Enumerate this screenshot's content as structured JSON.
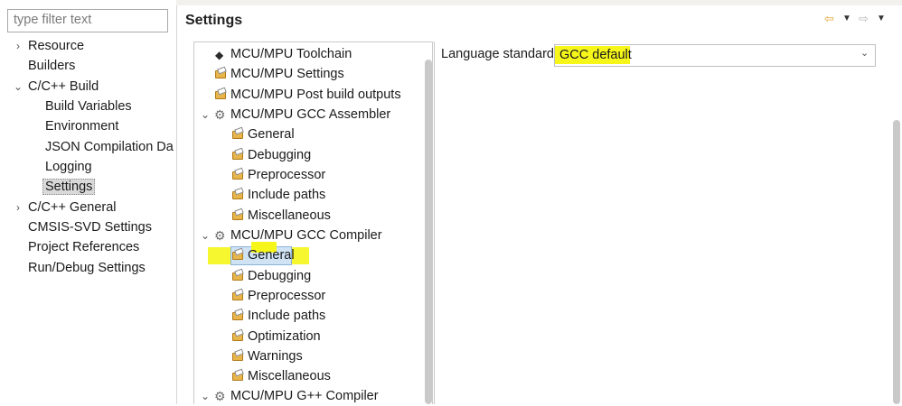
{
  "filter": {
    "placeholder": "type filter text"
  },
  "nav": {
    "items": [
      {
        "label": "Resource",
        "arrow": ">"
      },
      {
        "label": "Builders",
        "arrow": ""
      },
      {
        "label": "C/C++ Build",
        "arrow": "v"
      },
      {
        "label": "Build Variables",
        "arrow": ""
      },
      {
        "label": "Environment",
        "arrow": ""
      },
      {
        "label": "JSON Compilation Da",
        "arrow": ""
      },
      {
        "label": "Logging",
        "arrow": ""
      },
      {
        "label": "Settings",
        "arrow": ""
      },
      {
        "label": "C/C++ General",
        "arrow": ">"
      },
      {
        "label": "CMSIS-SVD Settings",
        "arrow": ""
      },
      {
        "label": "Project References",
        "arrow": ""
      },
      {
        "label": "Run/Debug Settings",
        "arrow": ""
      }
    ]
  },
  "header": {
    "title": "Settings",
    "icons": [
      "back-arrow-icon",
      "dropdown-icon",
      "forward-arrow-icon",
      "dropdown-icon"
    ]
  },
  "tree": {
    "items": [
      {
        "label": "MCU/MPU Toolchain",
        "icon": "tool-icon"
      },
      {
        "label": "MCU/MPU Settings",
        "icon": "settings-folder-icon"
      },
      {
        "label": "MCU/MPU Post build outputs",
        "icon": "settings-folder-icon"
      },
      {
        "label": "MCU/MPU GCC Assembler",
        "icon": "gear-icon",
        "arrow": "v"
      },
      {
        "label": "General",
        "icon": "settings-folder-icon"
      },
      {
        "label": "Debugging",
        "icon": "settings-folder-icon"
      },
      {
        "label": "Preprocessor",
        "icon": "settings-folder-icon"
      },
      {
        "label": "Include paths",
        "icon": "settings-folder-icon"
      },
      {
        "label": "Miscellaneous",
        "icon": "settings-folder-icon"
      },
      {
        "label": "MCU/MPU GCC Compiler",
        "icon": "gear-icon",
        "arrow": "v"
      },
      {
        "label": "General",
        "icon": "settings-folder-icon"
      },
      {
        "label": "Debugging",
        "icon": "settings-folder-icon"
      },
      {
        "label": "Preprocessor",
        "icon": "settings-folder-icon"
      },
      {
        "label": "Include paths",
        "icon": "settings-folder-icon"
      },
      {
        "label": "Optimization",
        "icon": "settings-folder-icon"
      },
      {
        "label": "Warnings",
        "icon": "settings-folder-icon"
      },
      {
        "label": "Miscellaneous",
        "icon": "settings-folder-icon"
      },
      {
        "label": "MCU/MPU G++ Compiler",
        "icon": "gear-icon",
        "arrow": "v"
      }
    ]
  },
  "options": {
    "language_standard_label": "Language standard",
    "language_standard_value": "GCC default"
  },
  "colors": {
    "highlight": "#f6f61a",
    "selection": "#cfe3f5",
    "nav_selected": "#d9d9d9",
    "arrow_icon": "#e0a22a"
  }
}
